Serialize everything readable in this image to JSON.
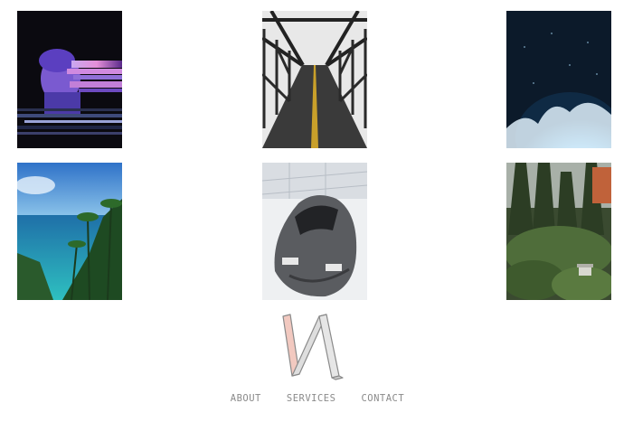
{
  "gallery": {
    "items": [
      {
        "icon": "glitch-portrait-image"
      },
      {
        "icon": "steel-bridge-road-image"
      },
      {
        "icon": "ocean-wave-splash-image"
      },
      {
        "icon": "tropical-coast-palms-image"
      },
      {
        "icon": "supercar-showroom-image"
      },
      {
        "icon": "forest-garden-image"
      }
    ]
  },
  "logo": {
    "icon": "n-monogram-logo",
    "colors": {
      "left": "#f2c9c0",
      "right": "#dedede",
      "stroke": "#8a8a8a"
    }
  },
  "nav": {
    "items": [
      {
        "label": "ABOUT"
      },
      {
        "label": "SERVICES"
      },
      {
        "label": "CONTACT"
      }
    ]
  }
}
